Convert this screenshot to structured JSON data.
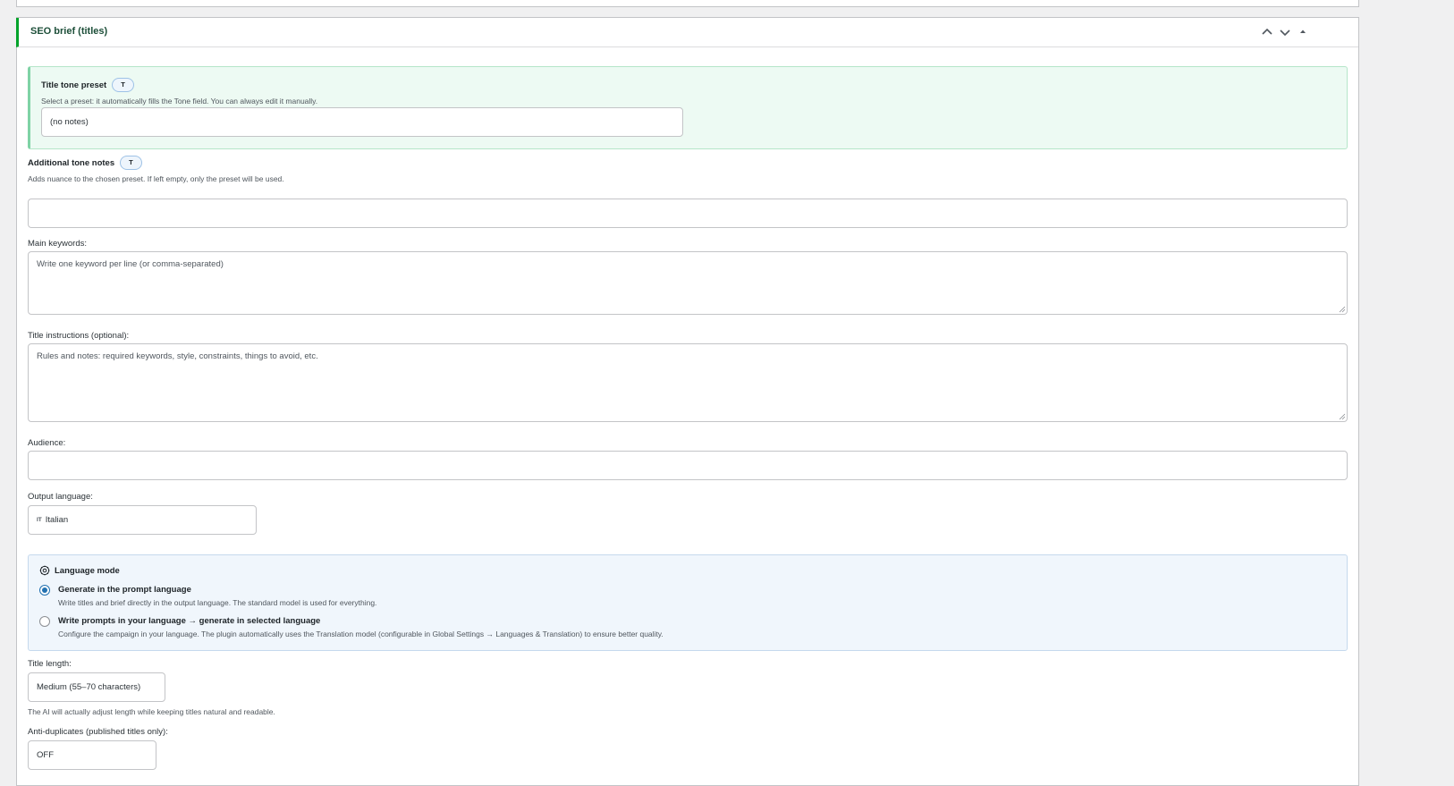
{
  "panel": {
    "title": "SEO brief (titles)"
  },
  "tone_preset": {
    "label": "Title tone preset",
    "badge": "T",
    "description": "Select a preset: it automatically fills the Tone field. You can always edit it manually.",
    "value": "(no notes)"
  },
  "additional_tone": {
    "label": "Additional tone notes",
    "badge": "T",
    "description": "Adds nuance to the chosen preset. If left empty, only the preset will be used.",
    "value": ""
  },
  "main_keywords": {
    "label": "Main keywords:",
    "placeholder": "Write one keyword per line (or comma-separated)"
  },
  "title_instructions": {
    "label": "Title instructions (optional):",
    "placeholder": "Rules and notes: required keywords, style, constraints, things to avoid, etc."
  },
  "audience": {
    "label": "Audience:",
    "value": ""
  },
  "output_language": {
    "label": "Output language:",
    "flag": "IT",
    "value": "Italian"
  },
  "language_mode": {
    "title": "Language mode",
    "options": [
      {
        "title": "Generate in the prompt language",
        "description": "Write titles and brief directly in the output language. The standard model is used for everything.",
        "selected": true
      },
      {
        "title": "Write prompts in your language → generate in selected language",
        "description": "Configure the campaign in your language. The plugin automatically uses the Translation model (configurable in Global Settings → Languages & Translation) to ensure better quality.",
        "selected": false
      }
    ]
  },
  "title_length": {
    "label": "Title length:",
    "value": "Medium (55–70 characters)",
    "note": "The AI will actually adjust length while keeping titles natural and readable."
  },
  "anti_duplicates": {
    "label": "Anti-duplicates (published titles only):",
    "value": "OFF"
  },
  "colors": {
    "accent_green": "#00a32a",
    "radio_blue": "#2271b1",
    "tone_box_bg": "#edfaf3",
    "lang_box_bg": "#f0f6fc"
  }
}
